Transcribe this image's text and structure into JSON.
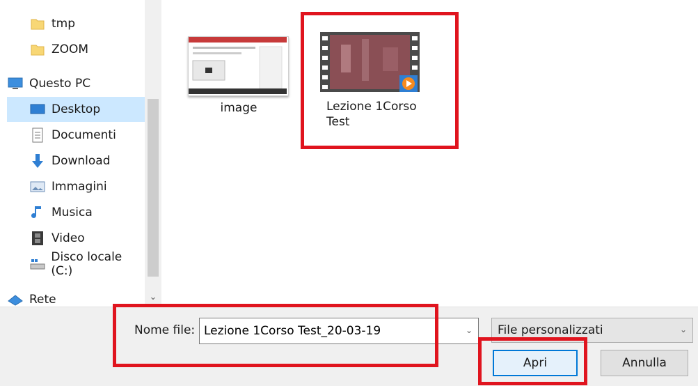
{
  "sidebar": {
    "items": [
      {
        "label": "tmp",
        "icon": "folder-icon"
      },
      {
        "label": "ZOOM",
        "icon": "folder-icon"
      },
      {
        "label": "Questo PC",
        "icon": "computer-icon"
      },
      {
        "label": "Desktop",
        "icon": "desktop-icon",
        "selected": true
      },
      {
        "label": "Documenti",
        "icon": "document-icon"
      },
      {
        "label": "Download",
        "icon": "download-icon"
      },
      {
        "label": "Immagini",
        "icon": "image-icon"
      },
      {
        "label": "Musica",
        "icon": "music-icon"
      },
      {
        "label": "Video",
        "icon": "video-icon"
      },
      {
        "label": "Disco locale (C:)",
        "icon": "drive-icon"
      },
      {
        "label": "Rete",
        "icon": "network-icon"
      }
    ]
  },
  "files": [
    {
      "name": "image",
      "type": "image"
    },
    {
      "name": "Lezione 1Corso Test",
      "type": "video"
    }
  ],
  "footer": {
    "filename_label": "Nome file:",
    "filename_value": "Lezione 1Corso Test_20-03-19",
    "filetype_value": "File personalizzati",
    "open_label": "Apri",
    "cancel_label": "Annulla"
  },
  "colors": {
    "accent": "#0078d7",
    "selection": "#cce8ff",
    "highlight_box": "#e0141e"
  }
}
